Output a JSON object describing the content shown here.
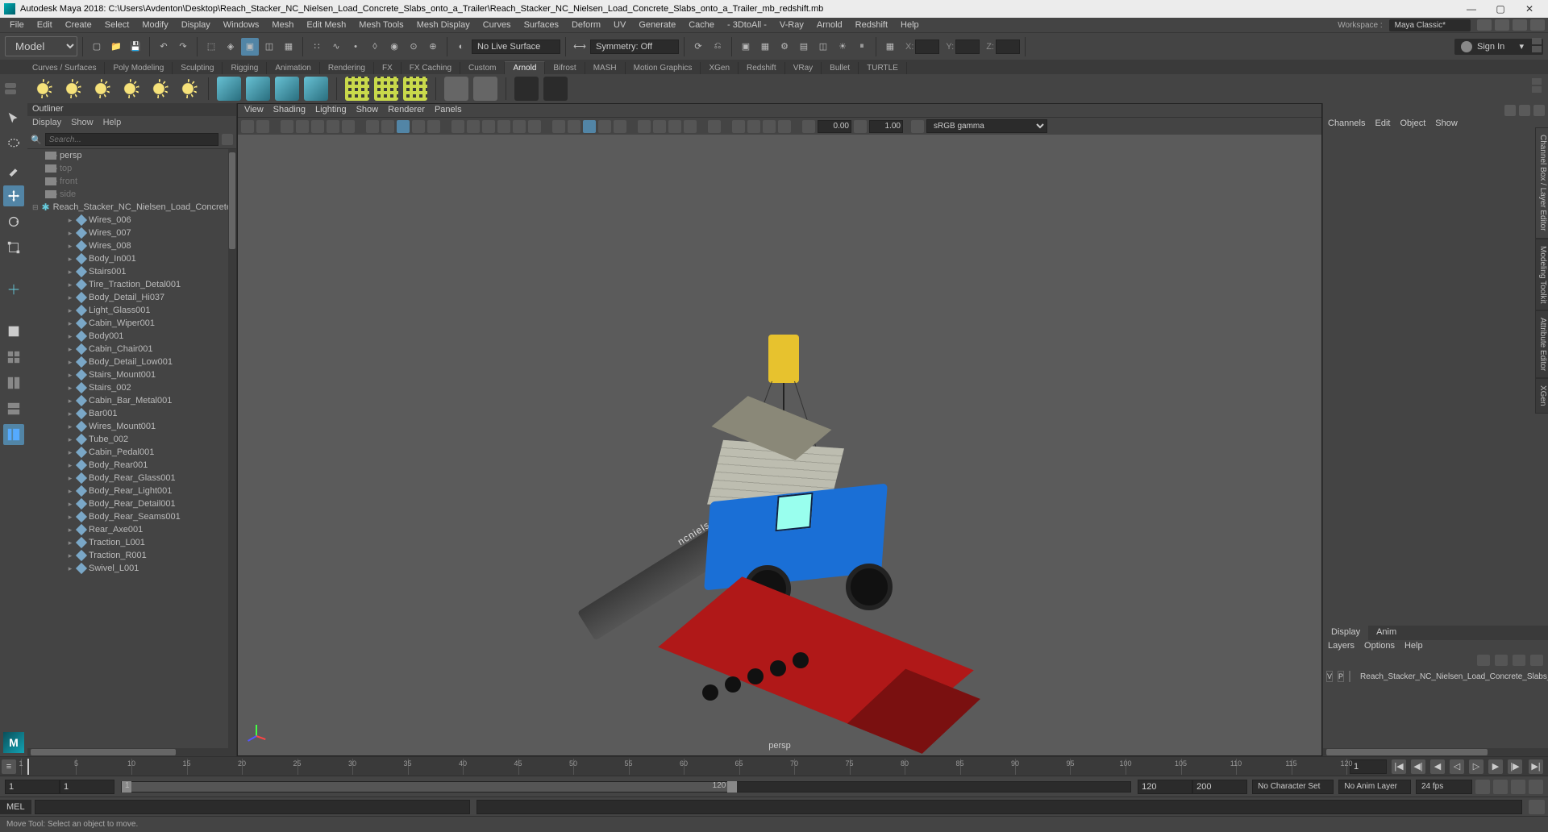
{
  "title": "Autodesk Maya 2018: C:\\Users\\Avdenton\\Desktop\\Reach_Stacker_NC_Nielsen_Load_Concrete_Slabs_onto_a_Trailer\\Reach_Stacker_NC_Nielsen_Load_Concrete_Slabs_onto_a_Trailer_mb_redshift.mb",
  "menubar": [
    "File",
    "Edit",
    "Create",
    "Select",
    "Modify",
    "Display",
    "Windows",
    "Mesh",
    "Edit Mesh",
    "Mesh Tools",
    "Mesh Display",
    "Curves",
    "Surfaces",
    "Deform",
    "UV",
    "Generate",
    "Cache",
    "- 3DtoAll -",
    "V-Ray",
    "Arnold",
    "Redshift",
    "Help"
  ],
  "workspace_label": "Workspace :",
  "workspace": "Maya Classic*",
  "mode": "Modeling",
  "live_surface": "No Live Surface",
  "symmetry": "Symmetry: Off",
  "signin": "Sign In",
  "coord_labels": {
    "x": "X:",
    "y": "Y:",
    "z": "Z:"
  },
  "shelf_tabs": [
    "Curves / Surfaces",
    "Poly Modeling",
    "Sculpting",
    "Rigging",
    "Animation",
    "Rendering",
    "FX",
    "FX Caching",
    "Custom",
    "Arnold",
    "Bifrost",
    "MASH",
    "Motion Graphics",
    "XGen",
    "Redshift",
    "VRay",
    "Bullet",
    "TURTLE"
  ],
  "shelf_active": "Arnold",
  "outliner": {
    "title": "Outliner",
    "menu": [
      "Display",
      "Show",
      "Help"
    ],
    "search_placeholder": "Search...",
    "cams": [
      "persp",
      "top",
      "front",
      "side"
    ],
    "root": "Reach_Stacker_NC_Nielsen_Load_Concrete_Slabs_onto_a_Trailer",
    "items": [
      "Wires_006",
      "Wires_007",
      "Wires_008",
      "Body_In001",
      "Stairs001",
      "Tire_Traction_Detal001",
      "Body_Detail_Hi037",
      "Light_Glass001",
      "Cabin_Wiper001",
      "Body001",
      "Cabin_Chair001",
      "Body_Detail_Low001",
      "Stairs_Mount001",
      "Stairs_002",
      "Cabin_Bar_Metal001",
      "Bar001",
      "Wires_Mount001",
      "Tube_002",
      "Cabin_Pedal001",
      "Body_Rear001",
      "Body_Rear_Glass001",
      "Body_Rear_Light001",
      "Body_Rear_Detail001",
      "Body_Rear_Seams001",
      "Rear_Axe001",
      "Traction_L001",
      "Traction_R001",
      "Swivel_L001"
    ]
  },
  "viewport": {
    "menu": [
      "View",
      "Shading",
      "Lighting",
      "Show",
      "Renderer",
      "Panels"
    ],
    "num1": "0.00",
    "num2": "1.00",
    "color_mgmt": "sRGB gamma",
    "label": "persp",
    "boom_text": "ncnielsen"
  },
  "channelbox": {
    "menu": [
      "Channels",
      "Edit",
      "Object",
      "Show"
    ],
    "tabs": [
      "Display",
      "Anim"
    ],
    "submenu": [
      "Layers",
      "Options",
      "Help"
    ],
    "layer_v": "V",
    "layer_p": "P",
    "layer_name": "Reach_Stacker_NC_Nielsen_Load_Concrete_Slabs_onto_a_Trailer"
  },
  "vtabs": [
    "Channel Box / Layer Editor",
    "Modeling Toolkit",
    "Attribute Editor",
    "XGen"
  ],
  "timeline": {
    "start": "1",
    "range_start": "1",
    "slider_start": "1",
    "slider_end": "120",
    "range_end": "120",
    "end": "200",
    "charset": "No Character Set",
    "animlayer": "No Anim Layer",
    "fps": "24 fps",
    "ticks": [
      "1",
      "5",
      "10",
      "15",
      "20",
      "25",
      "30",
      "35",
      "40",
      "45",
      "50",
      "55",
      "60",
      "65",
      "70",
      "75",
      "80",
      "85",
      "90",
      "95",
      "100",
      "105",
      "110",
      "115",
      "120"
    ]
  },
  "cmd": {
    "label": "MEL"
  },
  "status": "Move Tool: Select an object to move."
}
